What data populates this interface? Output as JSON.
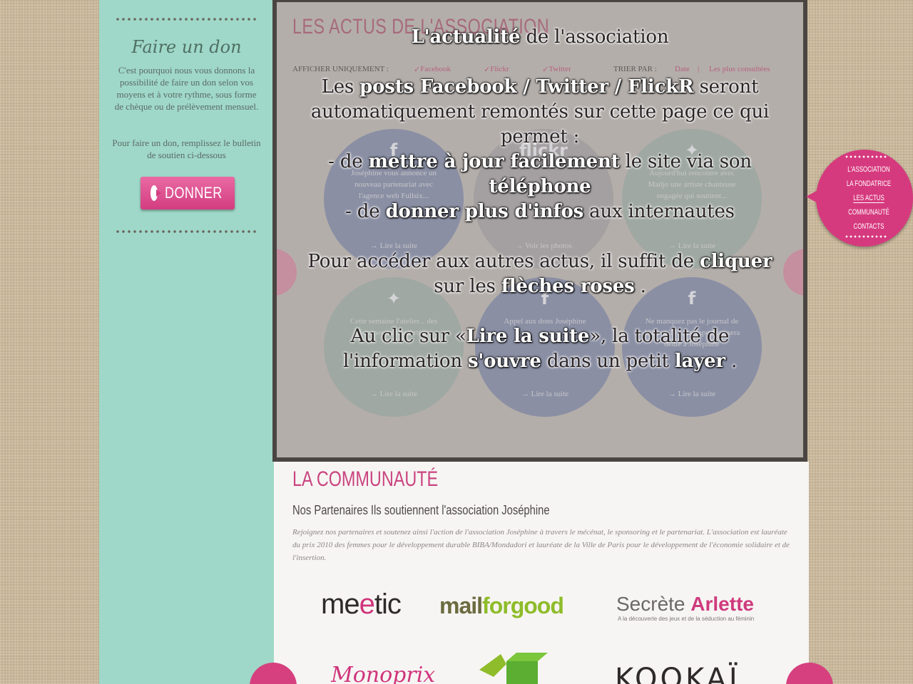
{
  "sidebar": {
    "title": "Faire un don",
    "text": "C'est pourquoi nous vous donnons la possibilité de faire un don selon vos moyens et à votre rythme, sous forme de chèque ou de prélèvement mensuel.",
    "text2": "Pour faire un don, remplissez le bulletin de soutien ci-dessous",
    "button_label": "DONNER",
    "button_icon": "arrow-right-icon"
  },
  "actus": {
    "title": "LES ACTUS DE L'ASSOCIATION",
    "filter": {
      "label": "AFFICHER UNIQUEMENT :",
      "options": [
        "Facebook",
        "Flickr",
        "Twitter"
      ],
      "sort_label": "TRIER PAR :",
      "sort_options": [
        "Date",
        "Les plus consultées"
      ]
    },
    "bubbles": [
      {
        "icon": "f",
        "text": "Joséphine vous annonce un nouveau partenariat avec l'agence web Fullsix...",
        "link": "→ Lire la suite"
      },
      {
        "icon": "flickr",
        "text": "",
        "link": "→ Voir les photos"
      },
      {
        "icon": "twitter-bird",
        "text": "Aujourd'hui rencontre avec Madjo une artiste chanteuse engagée qui soutient...",
        "link": "→ Lire la suite"
      },
      {
        "icon": "twitter-bird",
        "text": "Cette semaine l'atelier... des femmes en réinsertion",
        "link": "→ Lire la suite"
      },
      {
        "icon": "f",
        "text": "Appel aux dons Joséphine",
        "link": "→ Lire la suite"
      },
      {
        "icon": "f",
        "text": "Ne manquez pas le journal de 13h sur TF1, un reportage sera dédié à Joséphine",
        "link": "→ Lire la suite"
      }
    ]
  },
  "overlay": {
    "l1a": "L'actualité",
    "l1b": "de l'association",
    "l2a": "Les",
    "l2b": "posts Facebook / Twitter / FlickR",
    "l2c": "seront",
    "l3": "automatiquement remontés sur cette page ce qui",
    "l4": "permet :",
    "l5a": "- de",
    "l5b": "mettre à jour facilement",
    "l5c": "le site via son",
    "l6": "téléphone",
    "l7a": "- de",
    "l7b": "donner plus d'infos",
    "l7c": "aux internautes",
    "l8a": "Pour accéder aux autres actus, il suffit de",
    "l8b": "cliquer",
    "l9a": "sur les",
    "l9b": "flèches roses",
    "l9c": ".",
    "l10a": "Au clic sur «",
    "l10b": "Lire la suite",
    "l10c": "», la totalité de",
    "l11a": "l'information",
    "l11b": "s'ouvre",
    "l11c": "dans un petit",
    "l11d": "layer",
    "l11e": "."
  },
  "community": {
    "title": "LA COMMUNAUTÉ",
    "subtitle": "Nos Partenaires Ils soutiennent l'association Joséphine",
    "body": "Rejoignez nos partenaires et soutenez ainsi l'action de l'association Joséphine à travers le mécénat, le sponsoring et le partenariat. L'association est lauréate du prix 2010 des femmes pour le développement durable BIBA/Mondadori et lauréate de la Ville de Paris pour le développement de l'économie solidaire et de l'insertion.",
    "logos": {
      "meetic_a": "me",
      "meetic_b": "e",
      "meetic_c": "tic",
      "mailforgood_a": "mail",
      "mailforgood_b": "forgood",
      "arlette_a": "Secrète ",
      "arlette_b": "Arlette",
      "arlette_sub": "A la découverte des jeux et de la séduction au féminin",
      "partial": "Monoprix",
      "kookai": "KOOKAÏ"
    }
  },
  "nav": {
    "items": [
      "L'ASSOCIATION",
      "LA FONDATRICE",
      "LES ACTUS",
      "COMMUNAUTÉ",
      "CONTACTS"
    ],
    "active_index": 2
  },
  "colors": {
    "pink": "#d63a7e",
    "mint": "#9fd8c8",
    "linen": "#cdbb9c"
  }
}
